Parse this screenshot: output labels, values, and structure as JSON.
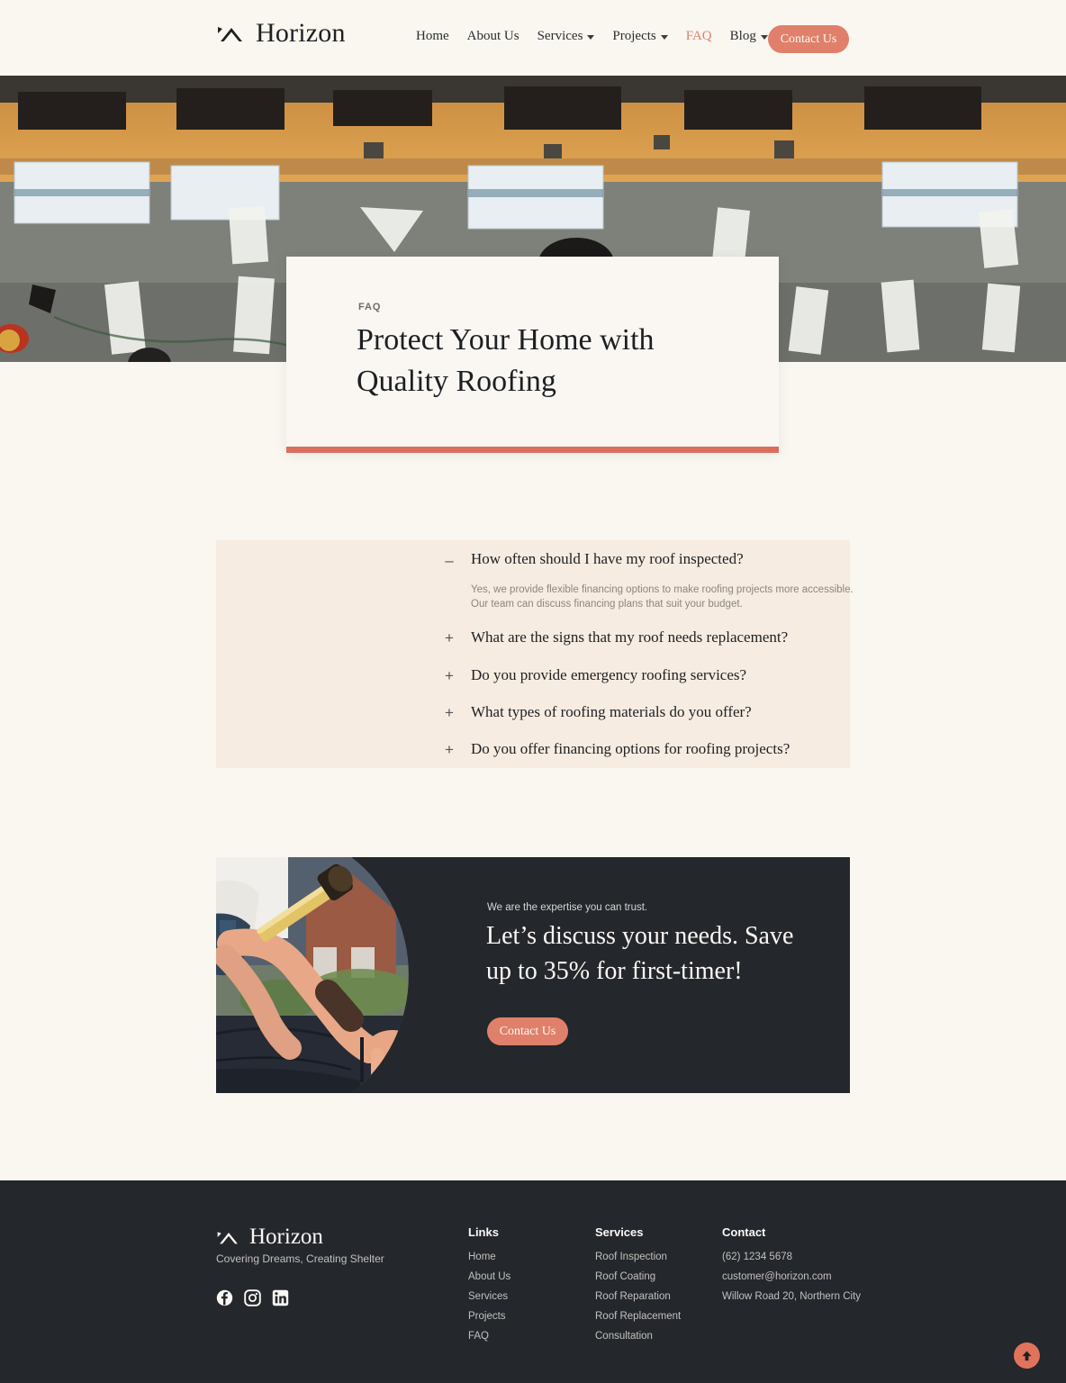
{
  "brand": {
    "name": "Horizon",
    "logo_icon": "roof-chevron-icon",
    "tagline": "Covering Dreams, Creating Shelter"
  },
  "colors": {
    "accent": "#e0806a",
    "accent_dark": "#d96f5c",
    "page_bg": "#faf6f0",
    "panel_bg": "#f6ece1",
    "dark": "#24272c"
  },
  "header": {
    "nav": [
      {
        "label": "Home",
        "has_dropdown": false,
        "active": false
      },
      {
        "label": "About Us",
        "has_dropdown": false,
        "active": false
      },
      {
        "label": "Services",
        "has_dropdown": true,
        "active": false
      },
      {
        "label": "Projects",
        "has_dropdown": true,
        "active": false
      },
      {
        "label": "FAQ",
        "has_dropdown": false,
        "active": true
      },
      {
        "label": "Blog",
        "has_dropdown": true,
        "active": false
      }
    ],
    "cta_label": "Contact Us"
  },
  "hero": {
    "eyebrow": "FAQ",
    "title_line1": "Protect Your Home with",
    "title_line2": "Quality Roofing",
    "image_alt": "aerial-roof-construction-photo"
  },
  "faq": {
    "items": [
      {
        "sign": "–",
        "question": "How often should I have my roof inspected?",
        "open": true,
        "answer_line1": "Yes, we provide flexible financing options to make roofing projects more accessible.",
        "answer_line2": "Our team can discuss financing plans that suit your budget."
      },
      {
        "sign": "+",
        "question": "What are the signs that my roof needs replacement?",
        "open": false
      },
      {
        "sign": "+",
        "question": "Do you provide emergency roofing services?",
        "open": false
      },
      {
        "sign": "+",
        "question": "What types of roofing materials do you offer?",
        "open": false
      },
      {
        "sign": "+",
        "question": "Do you offer financing options for roofing projects?",
        "open": false
      }
    ]
  },
  "cta": {
    "eyebrow": "We are the expertise you can trust.",
    "title_line1": "Let’s discuss your needs. Save",
    "title_line2": "up to 35% for first-timer!",
    "button_label": "Contact Us",
    "image_alt": "roofer-hammering-shingle-photo"
  },
  "footer": {
    "socials": [
      {
        "name": "facebook-icon"
      },
      {
        "name": "instagram-icon"
      },
      {
        "name": "linkedin-icon"
      }
    ],
    "columns": [
      {
        "title": "Links",
        "items": [
          "Home",
          "About Us",
          "Services",
          "Projects",
          "FAQ"
        ]
      },
      {
        "title": "Services",
        "items": [
          "Roof Inspection",
          "Roof Coating",
          "Roof Reparation",
          "Roof Replacement",
          "Consultation"
        ]
      },
      {
        "title": "Contact",
        "items": [
          "(62) 1234 5678",
          "customer@horizon.com",
          "Willow Road 20, Northern City"
        ]
      }
    ],
    "scroll_top_icon": "arrow-up-icon"
  }
}
